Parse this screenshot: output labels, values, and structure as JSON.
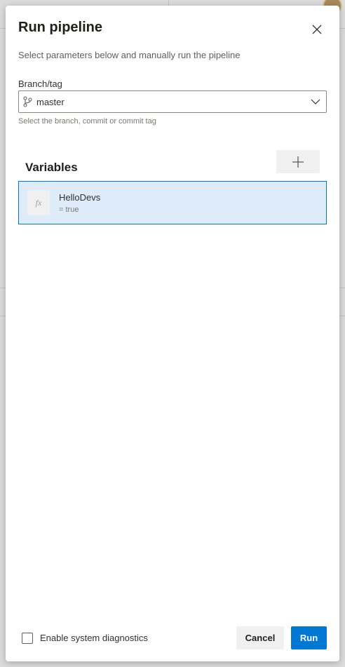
{
  "dialog": {
    "title": "Run pipeline",
    "subtitle": "Select parameters below and manually run the pipeline"
  },
  "branch": {
    "label": "Branch/tag",
    "value": "master",
    "help": "Select the branch, commit or commit tag",
    "icon": "git-branch-icon"
  },
  "variables": {
    "title": "Variables",
    "items": [
      {
        "name": "HelloDevs",
        "value": "= true",
        "icon_text": "fx"
      }
    ]
  },
  "footer": {
    "diagnostics_label": "Enable system diagnostics",
    "diagnostics_checked": false,
    "cancel_label": "Cancel",
    "run_label": "Run"
  },
  "colors": {
    "accent": "#0078d4",
    "selected_row": "#deecf9",
    "neutral_button": "#f0f0f0"
  }
}
